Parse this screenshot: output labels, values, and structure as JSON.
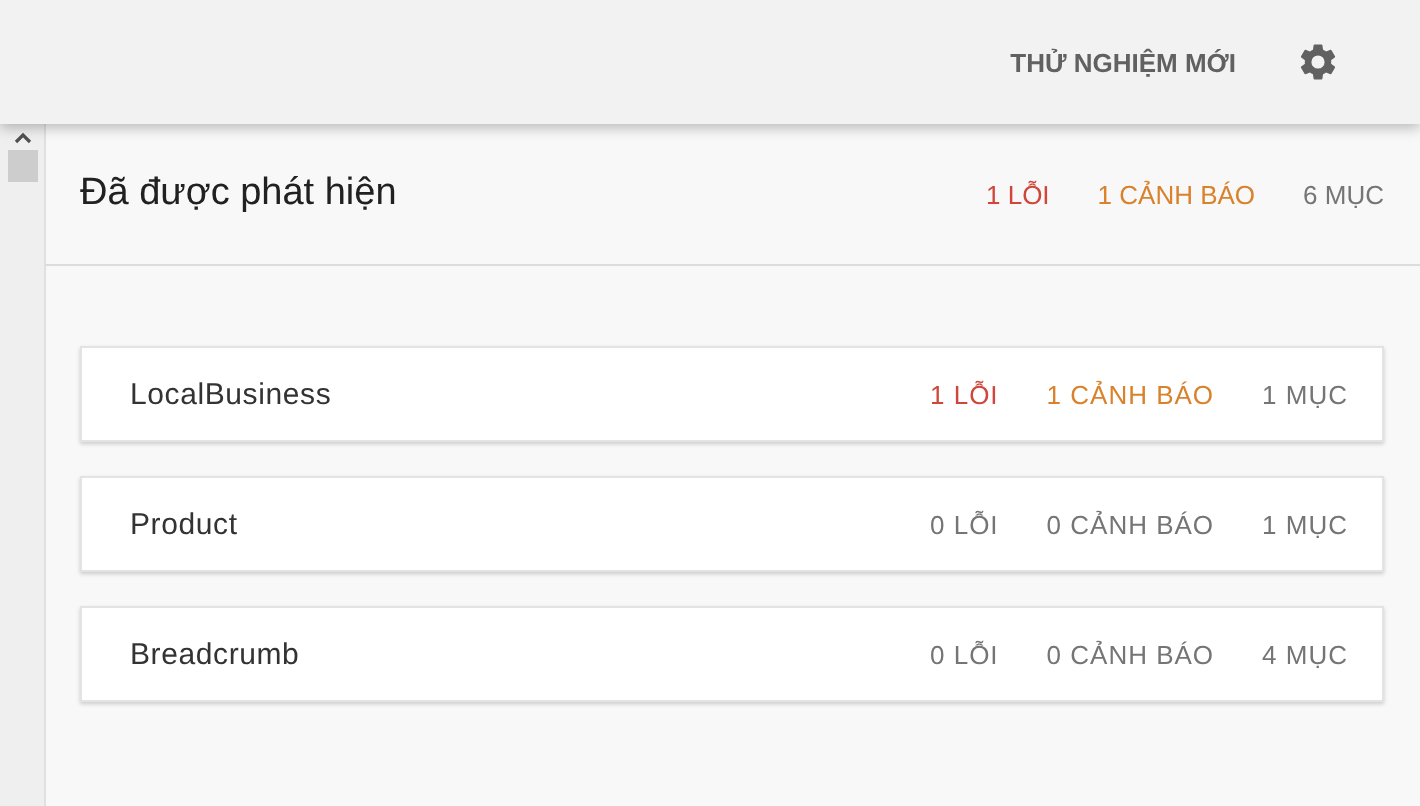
{
  "toolbar": {
    "new_test_button": "THỬ NGHIỆM MỚI"
  },
  "summary": {
    "title": "Đã được phát hiện",
    "counts": [
      {
        "kind": "error",
        "text": "1 LỖI",
        "flagged": true
      },
      {
        "kind": "warning",
        "text": "1 CẢNH BÁO",
        "flagged": true
      },
      {
        "kind": "item",
        "text": "6 MỤC",
        "flagged": false
      }
    ]
  },
  "results": [
    {
      "name": "LocalBusiness",
      "counts": [
        {
          "kind": "error",
          "text": "1 LỖI",
          "flagged": true
        },
        {
          "kind": "warning",
          "text": "1 CẢNH BÁO",
          "flagged": true
        },
        {
          "kind": "item",
          "text": "1 MỤC",
          "flagged": false
        }
      ]
    },
    {
      "name": "Product",
      "counts": [
        {
          "kind": "error",
          "text": "0 LỖI",
          "flagged": false
        },
        {
          "kind": "warning",
          "text": "0 CẢNH BÁO",
          "flagged": false
        },
        {
          "kind": "item",
          "text": "1 MỤC",
          "flagged": false
        }
      ]
    },
    {
      "name": "Breadcrumb",
      "counts": [
        {
          "kind": "error",
          "text": "0 LỖI",
          "flagged": false
        },
        {
          "kind": "warning",
          "text": "0 CẢNH BÁO",
          "flagged": false
        },
        {
          "kind": "item",
          "text": "4 MỤC",
          "flagged": false
        }
      ]
    }
  ]
}
